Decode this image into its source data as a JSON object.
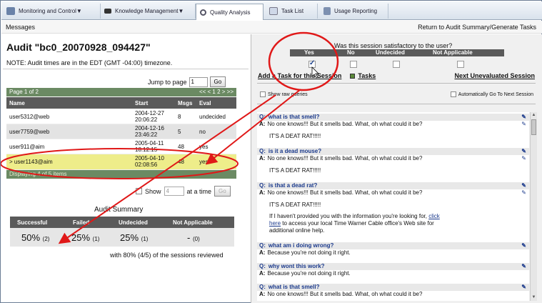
{
  "nav": {
    "tabs": [
      {
        "label": "Monitoring and Control▼",
        "icon": "monitor-icon"
      },
      {
        "label": "Knowledge Management▼",
        "icon": "graduation-cap-icon"
      },
      {
        "label": "Quality Analysis",
        "icon": "magnifier-icon"
      },
      {
        "label": "Task List",
        "icon": "checklist-icon"
      },
      {
        "label": "Usage Reporting",
        "icon": "report-icon"
      }
    ]
  },
  "subheader": {
    "messages": "Messages",
    "return_link": "Return to Audit Summary/Generate Tasks"
  },
  "audit": {
    "title": "Audit \"bc0_20070928_094427\"",
    "note": "NOTE: Audit times are in the EDT (GMT -04:00) timezone.",
    "jump_label": "Jump to page",
    "jump_value": "1",
    "go": "Go"
  },
  "table": {
    "page_info": "Page 1 of 2",
    "pager": "<< < 1 2 > >>",
    "headers": [
      "Name",
      "Start",
      "Msgs",
      "Eval"
    ],
    "rows": [
      {
        "name": "user5312@web",
        "start1": "2004-12-27",
        "start2": "20:06:22",
        "msgs": "8",
        "eval": "undecided"
      },
      {
        "name": "user7759@web",
        "start1": "2004-12-16",
        "start2": "23:46:22",
        "msgs": "5",
        "eval": "no"
      },
      {
        "name": "user911@aim",
        "start1": "2005-04-11",
        "start2": "18:12:15",
        "msgs": "48",
        "eval": "yes"
      },
      {
        "name": "> user1143@aim",
        "start1": "2005-04-10",
        "start2": "02:08:56",
        "msgs": "48",
        "eval": "yes"
      }
    ],
    "footer": "Displaying 4 of 5 items",
    "show_label": "Show",
    "show_value": "4",
    "at_a_time": "at a time",
    "go": "Go"
  },
  "summary": {
    "title": "Audit Summary",
    "headers": [
      "Successful",
      "Failed",
      "Undecided",
      "Not Applicable"
    ],
    "values": [
      {
        "pct": "50%",
        "count": "(2)"
      },
      {
        "pct": "25%",
        "count": "(1)"
      },
      {
        "pct": "25%",
        "count": "(1)"
      },
      {
        "pct": "-",
        "count": "(0)"
      }
    ],
    "reviewed": "with 80% (4/5) of the sessions reviewed"
  },
  "evaluation": {
    "question": "Was this session satisfactory to the user?",
    "options": [
      "Yes",
      "No",
      "Undecided",
      "Not Applicable"
    ],
    "selected": "Yes",
    "add_task": "Add a Task for this Session",
    "tasks": "Tasks",
    "next_unevaluated": "Next Unevaluated Session",
    "show_raw": "Show raw queries",
    "auto_go": "Automatically Go To Next Session"
  },
  "conversation": [
    {
      "q": "what is that smell?",
      "a": "No one knows!!!  But it smells bad.  What, oh what could it be?",
      "sub": "IT'S A DEAT RAT!!!!!"
    },
    {
      "q": "is it a dead mouse?",
      "a": "No one knows!!!  But it smells bad.  What, oh what could it be?",
      "sub": "IT'S A DEAT RAT!!!!!"
    },
    {
      "q": "is that a dead rat?",
      "a": "No one knows!!!  But it smells bad.  What, oh what could it be?",
      "sub": "IT'S A DEAT RAT!!!!!",
      "extra1": "If I haven't provided you with the information you're looking for,",
      "extra_link1": "click",
      "extra_link2": "here",
      "extra2": " to access your local Time Warner Cable office's Web site for",
      "extra3": "additional online help."
    },
    {
      "q": "what am i doing wrong?",
      "a": "Because you're not doing it right."
    },
    {
      "q": "why wont this work?",
      "a": "Because you're not doing it right."
    },
    {
      "q": "what is that smell?",
      "a": "No one knows!!!  But it smells bad.  What, oh what could it be?"
    }
  ],
  "qa_labels": {
    "q": "Q:",
    "a": "A:"
  },
  "colors": {
    "highlight": "#eeed8a",
    "annotation_red": "#e01818",
    "pager_green": "#6b8a63",
    "header_gray": "#5a5a5a"
  }
}
